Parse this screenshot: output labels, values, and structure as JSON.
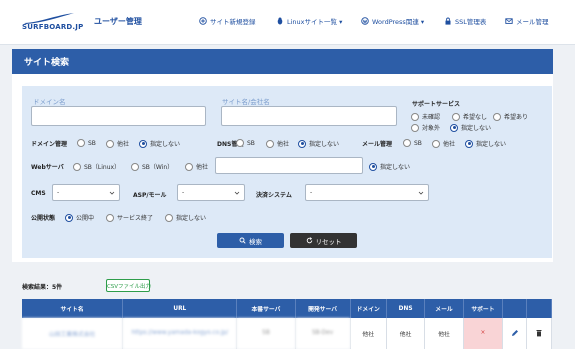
{
  "header": {
    "logo_text": "SURFBOARD.JP",
    "title": "ユーザー管理",
    "nav": [
      {
        "label": "サイト新規登録",
        "icon": "plus-circle-icon"
      },
      {
        "label": "Linuxサイト一覧 ▾",
        "icon": "linux-icon"
      },
      {
        "label": "WordPress関連 ▾",
        "icon": "wordpress-icon"
      },
      {
        "label": "SSL管理表",
        "icon": "lock-icon"
      },
      {
        "label": "メール管理",
        "icon": "mail-icon"
      }
    ]
  },
  "panel": {
    "title": "サイト検索"
  },
  "form": {
    "domain_label": "ドメイン名",
    "domain_value": "",
    "site_label": "サイト名/会社名",
    "site_value": "",
    "support": {
      "label": "サポートサービス",
      "options": [
        "未確認",
        "希望なし",
        "希望あり",
        "対象外",
        "指定しない"
      ],
      "selected": "指定しない"
    },
    "domain_mgmt": {
      "label": "ドメイン管理",
      "options": [
        "SB",
        "他社",
        "指定しない"
      ],
      "selected": "指定しない"
    },
    "dns_mgmt": {
      "label": "DNS管理",
      "options": [
        "SB",
        "他社",
        "指定しない"
      ],
      "selected": "指定しない"
    },
    "mail_mgmt": {
      "label": "メール管理",
      "options": [
        "SB",
        "他社",
        "指定しない"
      ],
      "selected": "指定しない"
    },
    "webserver": {
      "label": "Webサーバ",
      "options": [
        "SB（Linux）",
        "SB（Win）",
        "他社",
        "指定しない"
      ],
      "selected": "指定しない",
      "other_value": ""
    },
    "cms": {
      "label": "CMS",
      "value": "-"
    },
    "asp": {
      "label": "ASP/モール",
      "value": "-"
    },
    "payment": {
      "label": "決済システム",
      "value": "-"
    },
    "status": {
      "label": "公開状態",
      "options": [
        "公開中",
        "サービス終了",
        "指定しない"
      ],
      "selected": "公開中"
    },
    "search_button": "検索",
    "reset_button": "リセット"
  },
  "results": {
    "label": "検索結果：5件",
    "csv_button": "CSVファイル出力",
    "columns": [
      "サイト名",
      "URL",
      "本番サーバ",
      "開発サーバ",
      "ドメイン",
      "DNS",
      "メール",
      "サポート",
      "",
      ""
    ],
    "rows": [
      {
        "site": "山田工業株式会社",
        "url": "https://www.yamada-kogyo.co.jp/",
        "prod": "SB",
        "dev": "SB-Dev",
        "domain": "他社",
        "dns": "他社",
        "mail": "他社",
        "support": "×"
      }
    ]
  },
  "colors": {
    "primary": "#2d5ea8",
    "form_bg": "#dde9f7",
    "csv_green": "#2e9d4a",
    "ng_bg": "#f9d4d6"
  }
}
